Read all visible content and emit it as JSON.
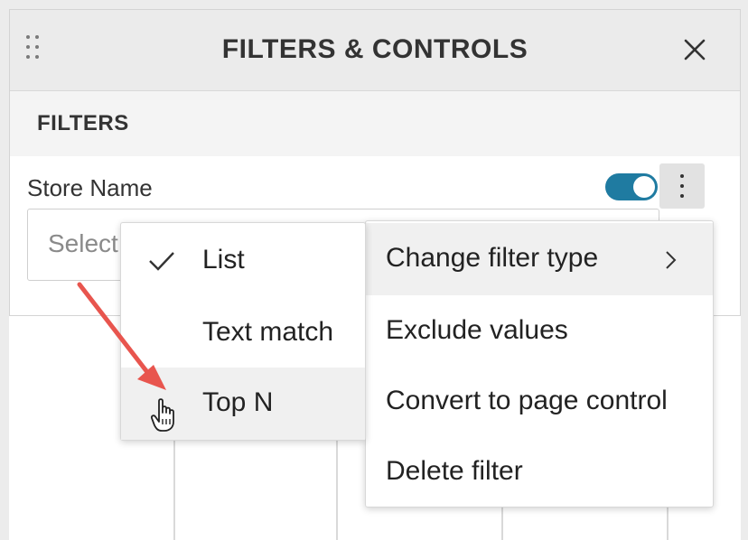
{
  "panel": {
    "title": "FILTERS & CONTROLS",
    "close_icon": "close-icon",
    "drag_icon": "drag-handle-icon"
  },
  "filters": {
    "section_title": "FILTERS",
    "filter_name": "Store Name",
    "enabled": true,
    "placeholder": "Select"
  },
  "context_menu": {
    "items": [
      {
        "label": "Change filter type",
        "submenu": true
      },
      {
        "label": "Exclude values"
      },
      {
        "label": "Convert to page control"
      },
      {
        "label": "Delete filter"
      }
    ]
  },
  "type_submenu": {
    "items": [
      {
        "label": "List",
        "checked": true
      },
      {
        "label": "Text match",
        "checked": false
      },
      {
        "label": "Top N",
        "checked": false
      }
    ]
  },
  "colors": {
    "accent": "#1f7ba1",
    "annotation_arrow": "#e8554e"
  }
}
